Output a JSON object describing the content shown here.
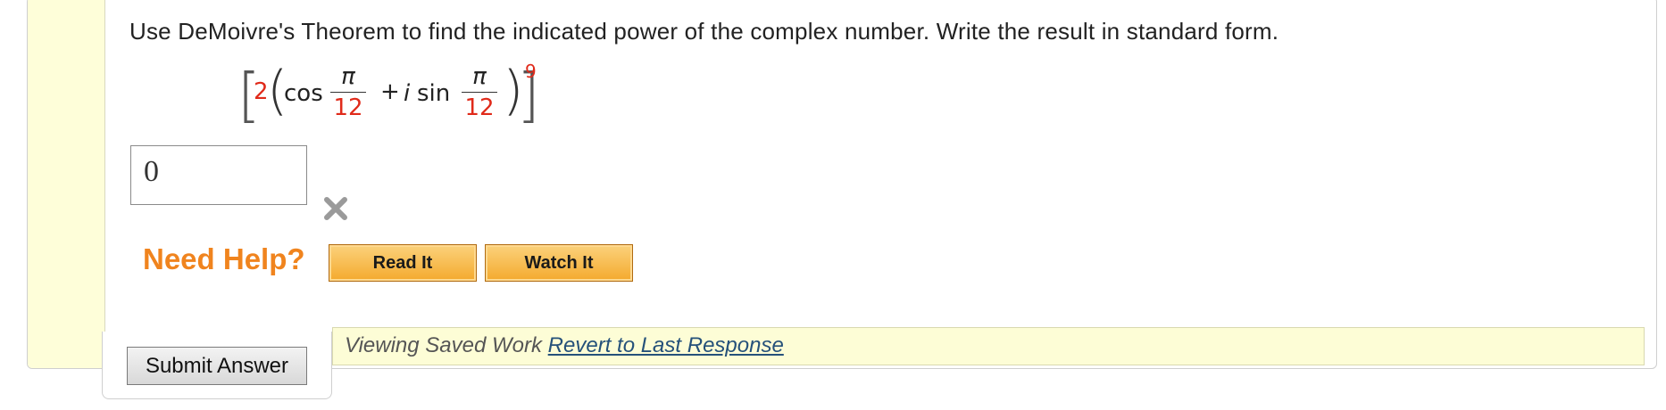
{
  "question": {
    "prompt": "Use DeMoivre's Theorem to find the indicated power of the complex number. Write the result in standard form.",
    "expression": {
      "coefficient": "2",
      "cos_label": "cos",
      "plus_label": "+",
      "i_label": "i",
      "sin_label": "sin",
      "numerator1": "π",
      "denominator1": "12",
      "numerator2": "π",
      "denominator2": "12",
      "exponent": "9"
    }
  },
  "answer": {
    "value": "0",
    "status": "incorrect",
    "status_icon": "x-mark-icon"
  },
  "help": {
    "title": "Need Help?",
    "read_it_label": "Read It",
    "watch_it_label": "Watch It"
  },
  "saved_work": {
    "message": "Viewing Saved Work",
    "revert_link": "Revert to Last Response"
  },
  "submit": {
    "label": "Submit Answer"
  },
  "colors": {
    "accent_orange": "#f0841e",
    "math_red": "#e02a1a",
    "gutter_yellow": "#fefed9",
    "link_blue": "#25517a"
  }
}
